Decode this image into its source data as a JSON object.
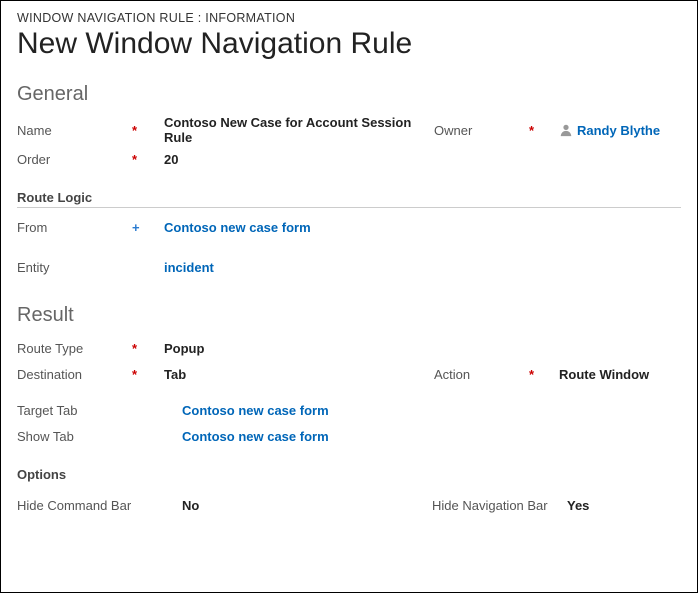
{
  "breadcrumb": "WINDOW NAVIGATION RULE : INFORMATION",
  "pageTitle": "New Window Navigation Rule",
  "sections": {
    "general": {
      "title": "General",
      "name": {
        "label": "Name",
        "value": "Contoso New Case for Account Session Rule",
        "required": "*"
      },
      "owner": {
        "label": "Owner",
        "value": "Randy Blythe",
        "required": "*"
      },
      "order": {
        "label": "Order",
        "value": "20",
        "required": "*"
      }
    },
    "routeLogic": {
      "title": "Route Logic",
      "from": {
        "label": "From",
        "value": "Contoso new case form",
        "marker": "+"
      },
      "entity": {
        "label": "Entity",
        "value": "incident"
      }
    },
    "result": {
      "title": "Result",
      "routeType": {
        "label": "Route Type",
        "value": "Popup",
        "required": "*"
      },
      "destination": {
        "label": "Destination",
        "value": "Tab",
        "required": "*"
      },
      "action": {
        "label": "Action",
        "value": "Route Window",
        "required": "*"
      },
      "targetTab": {
        "label": "Target Tab",
        "value": "Contoso new case form"
      },
      "showTab": {
        "label": "Show Tab",
        "value": "Contoso new case form"
      }
    },
    "options": {
      "title": "Options",
      "hideCommandBar": {
        "label": "Hide Command Bar",
        "value": "No"
      },
      "hideNavBar": {
        "label": "Hide Navigation Bar",
        "value": "Yes"
      }
    }
  }
}
